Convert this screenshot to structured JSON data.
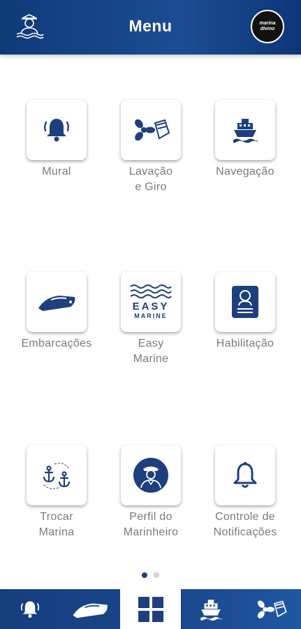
{
  "header": {
    "title": "Menu",
    "left_icon": "sailor-avatar-icon",
    "logo_line1": "marina",
    "logo_line2": "divino"
  },
  "menu": {
    "items": [
      {
        "icon": "bell-ring-icon",
        "label_line1": "Mural",
        "label_line2": ""
      },
      {
        "icon": "propeller-wash-icon",
        "label_line1": "Lavação",
        "label_line2": "e Giro"
      },
      {
        "icon": "ship-icon",
        "label_line1": "Navegação",
        "label_line2": ""
      },
      {
        "icon": "speedboat-icon",
        "label_line1": "Embarcações",
        "label_line2": ""
      },
      {
        "icon": "easy-marine-logo",
        "label_line1": "Easy",
        "label_line2": "Marine"
      },
      {
        "icon": "license-card-icon",
        "label_line1": "Habilitação",
        "label_line2": ""
      },
      {
        "icon": "swap-anchor-icon",
        "label_line1": "Trocar",
        "label_line2": "Marina"
      },
      {
        "icon": "sailor-profile-icon",
        "label_line1": "Perfil do",
        "label_line2": "Marinheiro"
      },
      {
        "icon": "bell-outline-icon",
        "label_line1": "Controle de",
        "label_line2": "Notificações"
      }
    ],
    "easy_marine_word1": "EASY",
    "easy_marine_word2": "MARINE"
  },
  "pagination": {
    "pages": 2,
    "current": 1
  },
  "bottom_nav": {
    "items": [
      {
        "icon": "bell-icon",
        "active": false
      },
      {
        "icon": "speedboat-icon",
        "active": false
      },
      {
        "icon": "grid-menu-icon",
        "active": true
      },
      {
        "icon": "ship-icon",
        "active": false
      },
      {
        "icon": "propeller-wash-icon",
        "active": false
      }
    ]
  },
  "colors": {
    "primary": "#1d3f7e",
    "header_gradient_start": "#0f3a78",
    "header_gradient_end": "#0d3677",
    "label_gray": "#7a7a7a",
    "icon_blue": "#1d3f7e"
  }
}
